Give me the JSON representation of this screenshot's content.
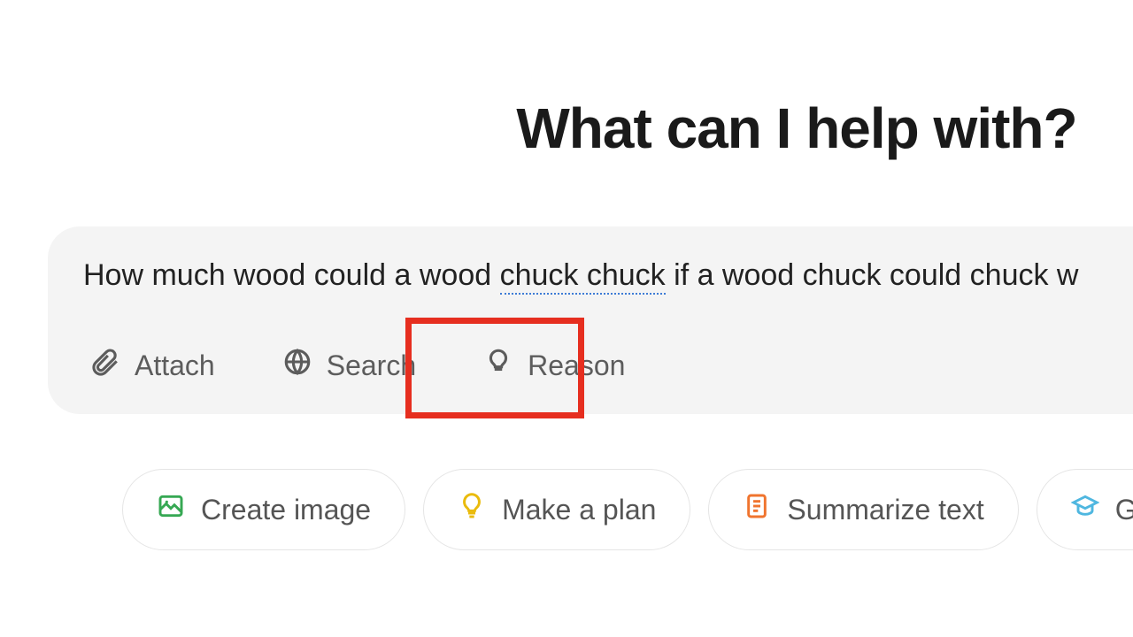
{
  "heading": "What can I help with?",
  "prompt": {
    "before": "How much wood could a wood ",
    "flagged": "chuck chuck",
    "after": " if a wood chuck could chuck w"
  },
  "tools": {
    "attach": "Attach",
    "search": "Search",
    "reason": "Reason"
  },
  "chips": {
    "create_image": "Create image",
    "make_plan": "Make a plan",
    "summarize": "Summarize text",
    "get_advice": "Get advic"
  },
  "colors": {
    "highlight": "#e62e1f",
    "create_image_icon": "#36a853",
    "make_plan_icon": "#eabb0c",
    "summarize_icon": "#f0742e",
    "get_advice_icon": "#4fb7e0"
  }
}
